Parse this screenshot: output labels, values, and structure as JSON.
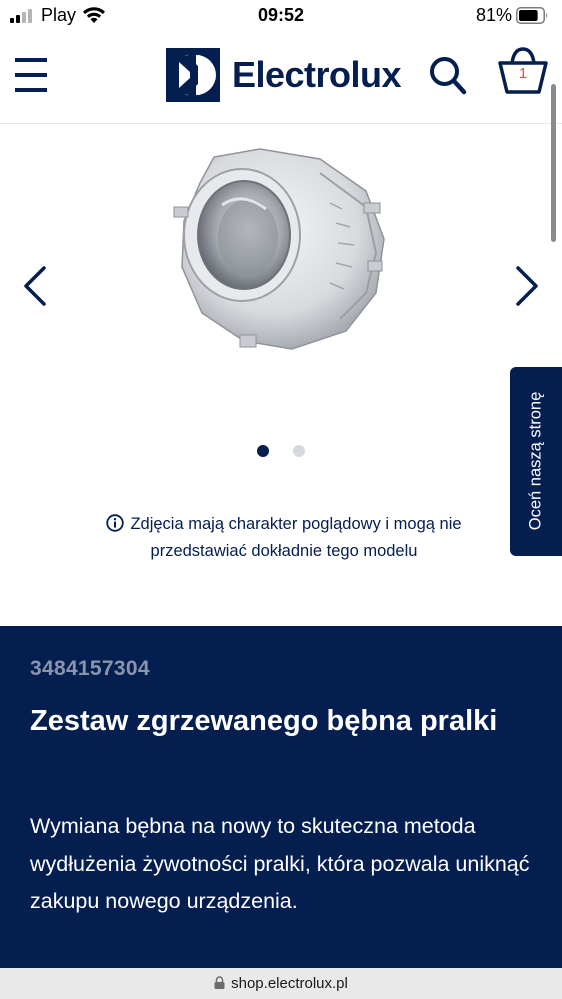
{
  "status_bar": {
    "carrier": "Play",
    "time": "09:52",
    "battery_percent": "81%",
    "battery_level": 0.81
  },
  "header": {
    "brand": "Electrolux",
    "cart_count": "1"
  },
  "gallery": {
    "active_image_index": 1,
    "image_count": 2
  },
  "disclaimer": {
    "text": "Zdjęcia mają charakter poglądowy i mogą nie przedstawiać dokładnie tego modelu"
  },
  "feedback_tab": {
    "label": "Oceń naszą stronę"
  },
  "product": {
    "sku": "3484157304",
    "title": "Zestaw zgrzewanego bębna pralki",
    "description": "Wymiana bębna na nowy to skuteczna metoda wydłużenia żywotności pralki, która pozwala uniknąć zakupu nowego urządzenia."
  },
  "browser": {
    "url": "shop.electrolux.pl"
  },
  "colors": {
    "brand_navy": "#041e50",
    "cart_badge": "#e74c3c",
    "sku_muted": "#8a95ad"
  }
}
